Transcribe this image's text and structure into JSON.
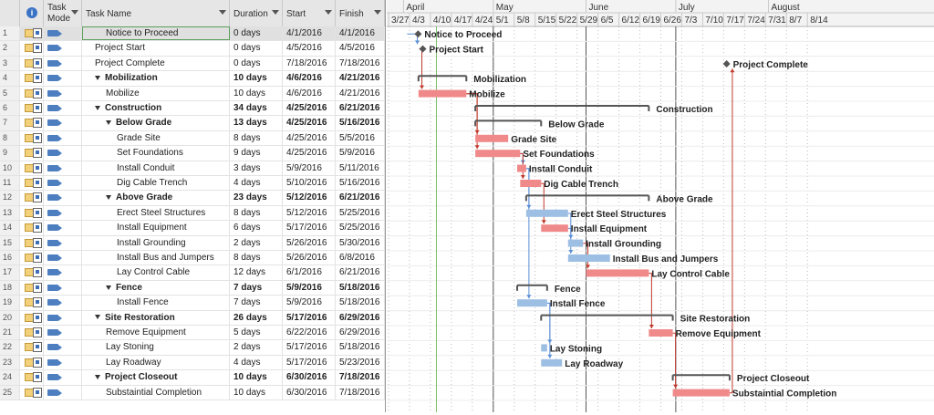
{
  "table": {
    "columns": {
      "info_icon": "info-icon",
      "task_mode": [
        "Task",
        "Mode"
      ],
      "task_name": "Task Name",
      "duration": "Duration",
      "start": "Start",
      "finish": "Finish"
    },
    "rows": [
      {
        "id": "1",
        "name": "Notice to Proceed",
        "duration": "0 days",
        "start": "4/1/2016",
        "finish": "4/1/2016",
        "level": 2,
        "summary": false,
        "selected": true
      },
      {
        "id": "2",
        "name": "Project Start",
        "duration": "0 days",
        "start": "4/5/2016",
        "finish": "4/5/2016",
        "level": 1,
        "summary": false
      },
      {
        "id": "3",
        "name": "Project Complete",
        "duration": "0 days",
        "start": "7/18/2016",
        "finish": "7/18/2016",
        "level": 1,
        "summary": false
      },
      {
        "id": "4",
        "name": "Mobilization",
        "duration": "10 days",
        "start": "4/6/2016",
        "finish": "4/21/2016",
        "level": 1,
        "summary": true
      },
      {
        "id": "5",
        "name": "Mobilize",
        "duration": "10 days",
        "start": "4/6/2016",
        "finish": "4/21/2016",
        "level": 2,
        "summary": false
      },
      {
        "id": "6",
        "name": "Construction",
        "duration": "34 days",
        "start": "4/25/2016",
        "finish": "6/21/2016",
        "level": 1,
        "summary": true
      },
      {
        "id": "7",
        "name": "Below Grade",
        "duration": "13 days",
        "start": "4/25/2016",
        "finish": "5/16/2016",
        "level": 2,
        "summary": true
      },
      {
        "id": "8",
        "name": "Grade Site",
        "duration": "8 days",
        "start": "4/25/2016",
        "finish": "5/5/2016",
        "level": 3,
        "summary": false
      },
      {
        "id": "9",
        "name": "Set Foundations",
        "duration": "9 days",
        "start": "4/25/2016",
        "finish": "5/9/2016",
        "level": 3,
        "summary": false
      },
      {
        "id": "10",
        "name": "Install Conduit",
        "duration": "3 days",
        "start": "5/9/2016",
        "finish": "5/11/2016",
        "level": 3,
        "summary": false
      },
      {
        "id": "11",
        "name": "Dig Cable Trench",
        "duration": "4 days",
        "start": "5/10/2016",
        "finish": "5/16/2016",
        "level": 3,
        "summary": false
      },
      {
        "id": "12",
        "name": "Above Grade",
        "duration": "23 days",
        "start": "5/12/2016",
        "finish": "6/21/2016",
        "level": 2,
        "summary": true
      },
      {
        "id": "13",
        "name": "Erect Steel Structures",
        "duration": "8 days",
        "start": "5/12/2016",
        "finish": "5/25/2016",
        "level": 3,
        "summary": false
      },
      {
        "id": "14",
        "name": "Install Equipment",
        "duration": "6 days",
        "start": "5/17/2016",
        "finish": "5/25/2016",
        "level": 3,
        "summary": false
      },
      {
        "id": "15",
        "name": "Install Grounding",
        "duration": "2 days",
        "start": "5/26/2016",
        "finish": "5/30/2016",
        "level": 3,
        "summary": false
      },
      {
        "id": "16",
        "name": "Install Bus and Jumpers",
        "duration": "8 days",
        "start": "5/26/2016",
        "finish": "6/8/2016",
        "level": 3,
        "summary": false
      },
      {
        "id": "17",
        "name": "Lay Control Cable",
        "duration": "12 days",
        "start": "6/1/2016",
        "finish": "6/21/2016",
        "level": 3,
        "summary": false
      },
      {
        "id": "18",
        "name": "Fence",
        "duration": "7 days",
        "start": "5/9/2016",
        "finish": "5/18/2016",
        "level": 2,
        "summary": true
      },
      {
        "id": "19",
        "name": "Install Fence",
        "duration": "7 days",
        "start": "5/9/2016",
        "finish": "5/18/2016",
        "level": 3,
        "summary": false
      },
      {
        "id": "20",
        "name": "Site Restoration",
        "duration": "26 days",
        "start": "5/17/2016",
        "finish": "6/29/2016",
        "level": 1,
        "summary": true
      },
      {
        "id": "21",
        "name": "Remove Equipment",
        "duration": "5 days",
        "start": "6/22/2016",
        "finish": "6/29/2016",
        "level": 2,
        "summary": false
      },
      {
        "id": "22",
        "name": "Lay Stoning",
        "duration": "2 days",
        "start": "5/17/2016",
        "finish": "5/18/2016",
        "level": 2,
        "summary": false
      },
      {
        "id": "23",
        "name": "Lay Roadway",
        "duration": "4 days",
        "start": "5/17/2016",
        "finish": "5/23/2016",
        "level": 2,
        "summary": false
      },
      {
        "id": "24",
        "name": "Project Closeout",
        "duration": "10 days",
        "start": "6/30/2016",
        "finish": "7/18/2016",
        "level": 1,
        "summary": true
      },
      {
        "id": "25",
        "name": "Substaintial Completion",
        "duration": "10 days",
        "start": "6/30/2016",
        "finish": "7/18/2016",
        "level": 2,
        "summary": false
      }
    ]
  },
  "gantt": {
    "months": [
      "April",
      "May",
      "June",
      "July",
      "August"
    ],
    "weeks": [
      "3/27",
      "4/3",
      "4/10",
      "4/17",
      "4/24",
      "5/1",
      "5/8",
      "5/15",
      "5/22",
      "5/29",
      "6/5",
      "6/12",
      "6/19",
      "6/26",
      "7/3",
      "7/10",
      "7/17",
      "7/24",
      "7/31",
      "8/7",
      "8/14"
    ],
    "colors": {
      "critical": "#f08a8a",
      "normal": "#9dbfe3",
      "summary": "#555555",
      "milestone": "#555555",
      "link_critical": "#c0392b",
      "link_normal": "#5b8fd6"
    }
  }
}
